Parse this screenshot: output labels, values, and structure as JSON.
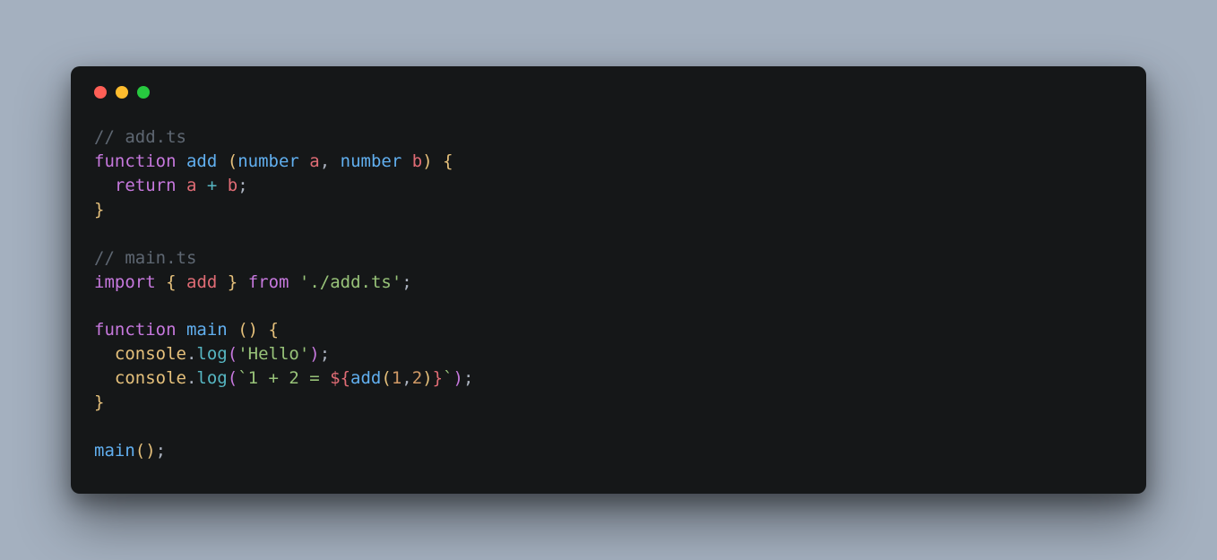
{
  "colors": {
    "background": "#a4b0bf",
    "window": "#151718",
    "traffic": {
      "red": "#ff5f56",
      "yellow": "#ffbd2e",
      "green": "#27c93f"
    },
    "syntax": {
      "comment": "#5e6772",
      "keyword": "#c678dd",
      "function": "#61afef",
      "type": "#61afef",
      "identifier": "#e06c75",
      "property": "#e5c07b",
      "method": "#56b6c2",
      "string": "#98c379",
      "number": "#d19a66",
      "plain": "#abb2bf",
      "brace": "#e5c07b"
    }
  },
  "code": {
    "lines": [
      [
        {
          "t": "comment",
          "v": "// add.ts"
        }
      ],
      [
        {
          "t": "keyword",
          "v": "function"
        },
        {
          "t": "plain",
          "v": " "
        },
        {
          "t": "func",
          "v": "add"
        },
        {
          "t": "plain",
          "v": " "
        },
        {
          "t": "brace",
          "v": "("
        },
        {
          "t": "type",
          "v": "number"
        },
        {
          "t": "plain",
          "v": " "
        },
        {
          "t": "ident",
          "v": "a"
        },
        {
          "t": "plain",
          "v": ", "
        },
        {
          "t": "type",
          "v": "number"
        },
        {
          "t": "plain",
          "v": " "
        },
        {
          "t": "ident",
          "v": "b"
        },
        {
          "t": "brace",
          "v": ")"
        },
        {
          "t": "plain",
          "v": " "
        },
        {
          "t": "brace",
          "v": "{"
        }
      ],
      [
        {
          "t": "plain",
          "v": "  "
        },
        {
          "t": "keyword",
          "v": "return"
        },
        {
          "t": "plain",
          "v": " "
        },
        {
          "t": "ident",
          "v": "a"
        },
        {
          "t": "plain",
          "v": " "
        },
        {
          "t": "method",
          "v": "+"
        },
        {
          "t": "plain",
          "v": " "
        },
        {
          "t": "ident",
          "v": "b"
        },
        {
          "t": "plain",
          "v": ";"
        }
      ],
      [
        {
          "t": "brace",
          "v": "}"
        }
      ],
      [],
      [
        {
          "t": "comment",
          "v": "// main.ts"
        }
      ],
      [
        {
          "t": "keyword",
          "v": "import"
        },
        {
          "t": "plain",
          "v": " "
        },
        {
          "t": "brace",
          "v": "{"
        },
        {
          "t": "plain",
          "v": " "
        },
        {
          "t": "ident",
          "v": "add"
        },
        {
          "t": "plain",
          "v": " "
        },
        {
          "t": "brace",
          "v": "}"
        },
        {
          "t": "plain",
          "v": " "
        },
        {
          "t": "keyword",
          "v": "from"
        },
        {
          "t": "plain",
          "v": " "
        },
        {
          "t": "string",
          "v": "'./add.ts'"
        },
        {
          "t": "plain",
          "v": ";"
        }
      ],
      [],
      [
        {
          "t": "keyword",
          "v": "function"
        },
        {
          "t": "plain",
          "v": " "
        },
        {
          "t": "func",
          "v": "main"
        },
        {
          "t": "plain",
          "v": " "
        },
        {
          "t": "brace",
          "v": "("
        },
        {
          "t": "brace",
          "v": ")"
        },
        {
          "t": "plain",
          "v": " "
        },
        {
          "t": "brace",
          "v": "{"
        }
      ],
      [
        {
          "t": "plain",
          "v": "  "
        },
        {
          "t": "property",
          "v": "console"
        },
        {
          "t": "plain",
          "v": "."
        },
        {
          "t": "method",
          "v": "log"
        },
        {
          "t": "paren",
          "v": "("
        },
        {
          "t": "string",
          "v": "'Hello'"
        },
        {
          "t": "paren",
          "v": ")"
        },
        {
          "t": "plain",
          "v": ";"
        }
      ],
      [
        {
          "t": "plain",
          "v": "  "
        },
        {
          "t": "property",
          "v": "console"
        },
        {
          "t": "plain",
          "v": "."
        },
        {
          "t": "method",
          "v": "log"
        },
        {
          "t": "paren",
          "v": "("
        },
        {
          "t": "string",
          "v": "`1 + 2 = "
        },
        {
          "t": "interp",
          "v": "${"
        },
        {
          "t": "func",
          "v": "add"
        },
        {
          "t": "brace",
          "v": "("
        },
        {
          "t": "number",
          "v": "1"
        },
        {
          "t": "plain",
          "v": ","
        },
        {
          "t": "number",
          "v": "2"
        },
        {
          "t": "brace",
          "v": ")"
        },
        {
          "t": "interp",
          "v": "}"
        },
        {
          "t": "string",
          "v": "`"
        },
        {
          "t": "paren",
          "v": ")"
        },
        {
          "t": "plain",
          "v": ";"
        }
      ],
      [
        {
          "t": "brace",
          "v": "}"
        }
      ],
      [],
      [
        {
          "t": "func",
          "v": "main"
        },
        {
          "t": "brace",
          "v": "("
        },
        {
          "t": "brace",
          "v": ")"
        },
        {
          "t": "plain",
          "v": ";"
        }
      ]
    ]
  }
}
